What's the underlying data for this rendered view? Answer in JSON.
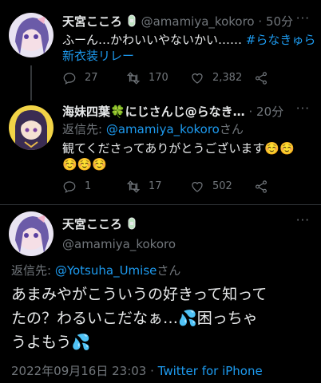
{
  "tweets": [
    {
      "name": "天宮こころ",
      "name_emoji": "🩹",
      "handle": "@amamiya_kokoro",
      "time": "50分",
      "text_line1_plain": "ふーん…かわいいやないかい……",
      "text_line1_hashtag": "#らなきゅら",
      "text_line2_hashtag": "新衣装リレー",
      "replies": "27",
      "retweets": "170",
      "likes": "2,382"
    },
    {
      "name": "海妹四葉🍀にじさんじ@らなき…",
      "time": "20分",
      "reply_label": "返信先: ",
      "reply_handle": "@amamiya_kokoro",
      "reply_suffix": "さん",
      "text_line1": "観てくださってありがとうございます☺️☺️",
      "text_line2": "☺️☺️☺️",
      "replies": "1",
      "retweets": "17",
      "likes": "502"
    }
  ],
  "main": {
    "name": "天宮こころ",
    "name_emoji": "🩹",
    "handle": "@amamiya_kokoro",
    "reply_label": "返信先: ",
    "reply_handle": "@Yotsuha_Umise",
    "reply_suffix": "さん",
    "line1": "あまみやがこういうの好きって知って",
    "line2_a": "たの？わるいこだなぁ…",
    "line2_drop": "💦",
    "line2_b": "困っちゃ",
    "line3_a": "うよもう",
    "line3_drop": "💦",
    "date": "2022年09月16日 23:03",
    "dot": " · ",
    "source": "Twitter for iPhone"
  },
  "icons": [
    "reply-icon",
    "retweet-icon",
    "like-icon",
    "share-icon",
    "more-icon",
    "bandage-icon",
    "clover-icon"
  ],
  "colors": {
    "link": "#1d9bf0",
    "muted": "#71767b",
    "text": "#e7e9ea",
    "bg": "#000000"
  }
}
